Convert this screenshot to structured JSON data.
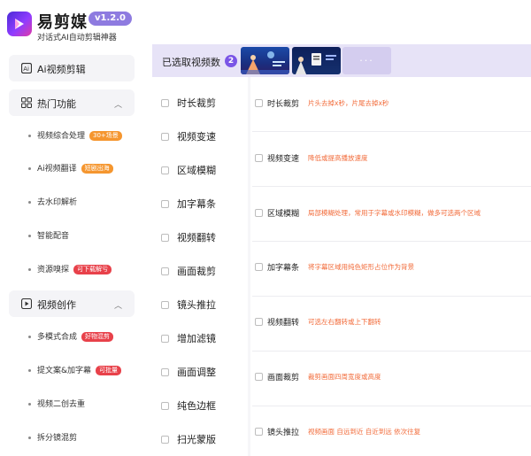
{
  "app": {
    "name": "易剪媒",
    "version": "v1.2.0",
    "tagline": "对话式AI自动剪辑神器"
  },
  "sidebar": {
    "ai_edit": "Ai视频剪辑",
    "groups": [
      {
        "label": "热门功能",
        "icon": "grid-icon",
        "items": [
          {
            "label": "视频综合处理",
            "tag": "30+场景",
            "tag_color": "#f5962f"
          },
          {
            "label": "Ai视频翻译",
            "tag": "短剧出海",
            "tag_color": "#f5962f"
          },
          {
            "label": "去水印解析",
            "tag": ""
          },
          {
            "label": "智能配音",
            "tag": ""
          },
          {
            "label": "资源嗅探",
            "tag": "可下载解亏",
            "tag_color": "#e8414a"
          }
        ]
      },
      {
        "label": "视频创作",
        "icon": "video-play-icon",
        "items": [
          {
            "label": "多模式合成",
            "tag": "好物混剪",
            "tag_color": "#e8414a"
          },
          {
            "label": "提文案&加字幕",
            "tag": "可批量",
            "tag_color": "#e8414a"
          },
          {
            "label": "视频二创去重",
            "tag": ""
          },
          {
            "label": "拆分镜混剪",
            "tag": ""
          }
        ]
      }
    ]
  },
  "selection": {
    "label": "已选取视频数",
    "count": "2",
    "more": "···"
  },
  "features": [
    "时长裁剪",
    "视频变速",
    "区域模糊",
    "加字幕条",
    "视频翻转",
    "画面裁剪",
    "镜头推拉",
    "增加滤镜",
    "画面调整",
    "纯色边框",
    "扫光蒙版"
  ],
  "details": [
    {
      "label": "时长裁剪",
      "desc": "片头去掉x秒，片尾去掉x秒"
    },
    {
      "label": "视频变速",
      "desc": "降低或提高播放速度"
    },
    {
      "label": "区域模糊",
      "desc": "局部模糊处理，常用于字幕或水印模糊，做多可选两个区域"
    },
    {
      "label": "加字幕条",
      "desc": "将字幕区域用纯色矩形占位作为背景"
    },
    {
      "label": "视频翻转",
      "desc": "可选左右翻转或上下翻转"
    },
    {
      "label": "画面裁剪",
      "desc": "裁剪画面四周宽度或高度"
    },
    {
      "label": "镜头推拉",
      "desc": "视频画面 自远到近 自近到远 依次往复"
    }
  ],
  "colors": {
    "accent": "#7a55e6",
    "header_bg": "#e7e3f7",
    "desc_text": "#f26b3a"
  }
}
